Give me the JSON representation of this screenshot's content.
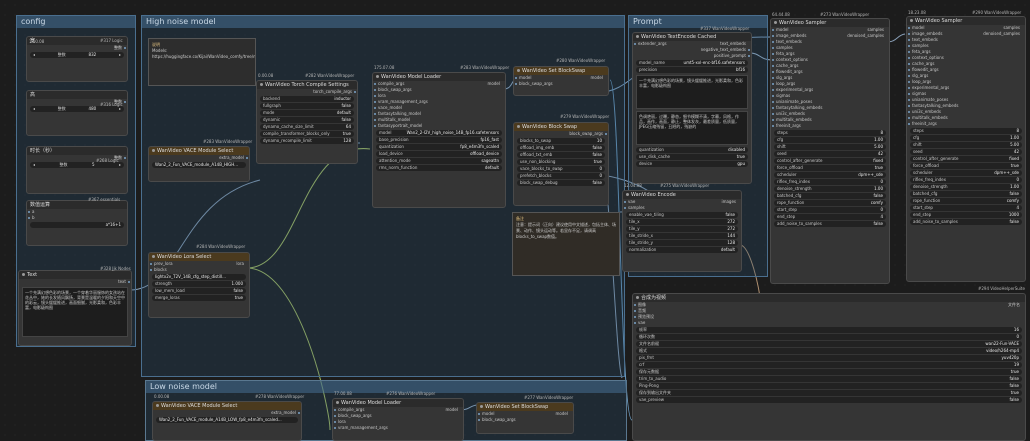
{
  "groups": {
    "config": "config",
    "high": "High noise model",
    "prompt": "Prompt",
    "low": "Low noise model"
  },
  "nodes": {
    "logic1": {
      "id": "#317 Logic",
      "time": "1.00.08",
      "label": "宽",
      "field": "整数",
      "field_value": "832"
    },
    "logic2": {
      "id": "#316 Logic",
      "time": "0.40.08",
      "label": "高",
      "field": "整数",
      "field_value": "480"
    },
    "logic3": {
      "id": "#268 Logic",
      "time": "0.40.08",
      "label": "时长（秒）",
      "field": "整数",
      "field_value": "5"
    },
    "essentials": {
      "id": "#367 essentials",
      "label": "数值运算",
      "a": "a",
      "b": "b",
      "expr": "a*16+1"
    },
    "text": {
      "id": "#328 Jjk Nodes",
      "time": "0.52.08",
      "title": "Text",
      "out": "text",
      "content": "一个充满幻想色彩的场景，一个穿着华丽服饰的女孩站在花丛中，她的长发随风飘扬，背景是温暖的夕阳和天空中的彩云，镜头缓缓推进，画面细腻，光影柔和，色彩丰富，电影级构图"
    },
    "note1": {
      "title": "说明",
      "content": "Models: https://huggingface.co/Kijai/WanVideo_comfy/tree/main/Wan22"
    },
    "compile": {
      "id": "#282 WanVideoWrapper",
      "time": "0.00.08",
      "title": "WanVideo Torch Compile Settings",
      "out": "torch_compile_args",
      "rows": [
        [
          "backend",
          "inductor"
        ],
        [
          "fullgraph",
          "false"
        ],
        [
          "mode",
          "default"
        ],
        [
          "dynamic",
          "false"
        ],
        [
          "dynamo_cache_size_limit",
          "64"
        ],
        [
          "compile_transformer_blocks_only",
          "true"
        ],
        [
          "dynamo_recompile_limit",
          "128"
        ]
      ]
    },
    "loader": {
      "id": "#283 WanVideoWrapper",
      "time": "175.07.08",
      "title": "WanVideo Model Loader",
      "out": "model",
      "ports": [
        "compile_args",
        "block_swap_args",
        "lora",
        "vram_management_args",
        "vace_model",
        "fantasytalking_model",
        "multitalk_model",
        "fantasyportrait_model"
      ],
      "rows": [
        [
          "model",
          "Wan2_2-I2V_high_noise_14B_fp16.safetensors"
        ],
        [
          "base_precision",
          "fp16_fast"
        ],
        [
          "quantization",
          "fp8_e4m3fn_scaled"
        ],
        [
          "load_device",
          "offload_device"
        ],
        [
          "attention_mode",
          "sageattn"
        ],
        [
          "rms_norm_function",
          "default"
        ]
      ]
    },
    "setblock": {
      "id": "#280 WanVideoWrapper",
      "time": "0.00.08",
      "title": "WanVideo Set BlockSwap",
      "ports": [
        "model",
        "block_swap_args"
      ],
      "out": "model"
    },
    "blockswap": {
      "id": "#279 WanVideoWrapper",
      "time": "0.00.08",
      "title": "WanVideo Block Swap",
      "out": "block_swap_args",
      "rows": [
        [
          "blocks_to_swap",
          "10"
        ],
        [
          "offload_img_emb",
          "false"
        ],
        [
          "offload_txt_emb",
          "false"
        ],
        [
          "use_non_blocking",
          "true"
        ],
        [
          "vace_blocks_to_swap",
          "0"
        ],
        [
          "prefetch_blocks",
          "0"
        ],
        [
          "block_swap_debug",
          "false"
        ]
      ]
    },
    "vace": {
      "id": "#283 WanVideoWrapper",
      "time": "0.00.08",
      "title": "WanVideo VACE Module Select",
      "out": "extra_model",
      "value": "Wan2_2_Fun_VACE_module_A14B_HIGH..."
    },
    "lora": {
      "id": "#284 WanVideoWrapper",
      "time": "0.00.08",
      "title": "WanVideo Lora Select",
      "ports": [
        "prev_lora",
        "blocks"
      ],
      "out": "lora",
      "rows": [
        [
          "lora",
          "lightx2v_T2V_14B_cfg_step_distill..."
        ],
        [
          "strength",
          "1.000"
        ],
        [
          "low_mem_load",
          "false"
        ],
        [
          "merge_loras",
          "true"
        ]
      ]
    },
    "note2": {
      "title": "备注",
      "content": "注意：提示词（正向）建议使用中文描述，包括主体、场景、动作、镜头运动等。若显存不足，请调高blocks_to_swap数值。"
    },
    "textencode": {
      "id": "#337 WanVideoWrapper",
      "time": "0.00.08",
      "title": "WanVideo TextEncode Cached",
      "in": "extender_args",
      "outs": [
        "text_embeds",
        "negative_text_embeds",
        "positive_prompt"
      ],
      "rows": [
        [
          "model_name",
          "umt5-xxl-enc-bf16.safetensors"
        ],
        [
          "precision",
          "bf16"
        ]
      ],
      "pos": "一个充满幻想色彩的场景，镜头缓缓推进，光影柔和，色彩丰富，电影级构图",
      "neg": "色调艳丽，过曝，静态，细节模糊不清，字幕，风格，作品，画作，画面，静止，整体发灰，最差质量，低质量，JPEG压缩残留，丑陋的，残缺的",
      "rows2": [
        [
          "quantization",
          "disabled"
        ],
        [
          "use_disk_cache",
          "true"
        ],
        [
          "device",
          "gpu"
        ]
      ]
    },
    "encode": {
      "id": "#275 WanVideoWrapper",
      "time": "12.04.08",
      "title": "WanVideo Encode",
      "ins": [
        "vae",
        "samples"
      ],
      "out": "images",
      "rows": [
        [
          "enable_vae_tiling",
          "false"
        ],
        [
          "tile_x",
          "272"
        ],
        [
          "tile_y",
          "272"
        ],
        [
          "tile_stride_x",
          "144"
        ],
        [
          "tile_stride_y",
          "128"
        ],
        [
          "normalization",
          "default"
        ]
      ]
    },
    "sampler1": {
      "id": "#273 WanVideoWrapper",
      "time": "64.44.08",
      "title": "WanVideo Sampler",
      "ins": [
        "model",
        "image_embeds",
        "text_embeds",
        "samples",
        "feta_args",
        "context_options",
        "cache_args",
        "flowedit_args",
        "slg_args",
        "loop_args",
        "experimental_args",
        "sigmas",
        "unianimate_poses",
        "fantasytalking_embeds",
        "uni3c_embeds",
        "multitalk_embeds",
        "freeinit_args"
      ],
      "outs": [
        "samples",
        "denoised_samples"
      ],
      "rows": [
        [
          "steps",
          "8"
        ],
        [
          "cfg",
          "1.00"
        ],
        [
          "shift",
          "5.00"
        ],
        [
          "seed",
          "42"
        ],
        [
          "control_after_generate",
          "fixed"
        ],
        [
          "force_offload",
          "true"
        ],
        [
          "scheduler",
          "dpm++_sde"
        ],
        [
          "riflex_freq_index",
          "0"
        ],
        [
          "denoise_strength",
          "1.00"
        ],
        [
          "batched_cfg",
          "false"
        ],
        [
          "rope_function",
          "comfy"
        ],
        [
          "start_step",
          "0"
        ],
        [
          "end_step",
          "4"
        ],
        [
          "add_noise_to_samples",
          "false"
        ]
      ]
    },
    "sampler2": {
      "id": "#290 WanVideoWrapper",
      "time": "18.23.08",
      "title": "WanVideo Sampler",
      "ins": [
        "model",
        "image_embeds",
        "text_embeds",
        "samples",
        "feta_args",
        "context_options",
        "cache_args",
        "flowedit_args",
        "slg_args",
        "loop_args",
        "experimental_args",
        "sigmas",
        "unianimate_poses",
        "fantasytalking_embeds",
        "uni3c_embeds",
        "multitalk_embeds",
        "freeinit_args"
      ],
      "outs": [
        "samples",
        "denoised_samples"
      ],
      "rows": [
        [
          "steps",
          "8"
        ],
        [
          "cfg",
          "1.00"
        ],
        [
          "shift",
          "5.00"
        ],
        [
          "seed",
          "42"
        ],
        [
          "control_after_generate",
          "fixed"
        ],
        [
          "force_offload",
          "true"
        ],
        [
          "scheduler",
          "dpm++_sde"
        ],
        [
          "riflex_freq_index",
          "0"
        ],
        [
          "denoise_strength",
          "1.00"
        ],
        [
          "batched_cfg",
          "false"
        ],
        [
          "rope_function",
          "comfy"
        ],
        [
          "start_step",
          "4"
        ],
        [
          "end_step",
          "1000"
        ],
        [
          "add_noise_to_samples",
          "false"
        ]
      ]
    },
    "combine": {
      "id": "#294 VideoHelperSuite",
      "title": "合成为视频",
      "out": "文件名",
      "ins": [
        "图像",
        "音频",
        "预览预设",
        "vae"
      ],
      "rows": [
        [
          "帧率",
          "16"
        ],
        [
          "循环次数",
          "0"
        ],
        [
          "文件名前缀",
          "wan22-Fun-VACE"
        ],
        [
          "格式",
          "video/h264-mp4"
        ],
        [
          "pix_fmt",
          "yuv420p"
        ],
        [
          "crf",
          "19"
        ],
        [
          "保存元数据",
          "true"
        ],
        [
          "trim_to_audio",
          "false"
        ],
        [
          "Ping-Pong",
          "false"
        ],
        [
          "保存到输出文件夹",
          "true"
        ],
        [
          "vae_preview",
          "false"
        ]
      ]
    },
    "lowvace": {
      "id": "#278 WanVideoWrapper",
      "time": "0.00.08",
      "title": "WanVideo VACE Module Select",
      "out": "extra_model",
      "value": "Wan2_2_Fun_VACE_module_A14B_LOW_fp8_e4m3fn_scaled..."
    },
    "lowloader": {
      "id": "#276 WanVideoWrapper",
      "time": "77.00.08",
      "title": "WanVideo Model Loader",
      "out": "model",
      "ports": [
        "compile_args",
        "block_swap_args",
        "lora",
        "vram_management_args"
      ]
    },
    "lowsetblock": {
      "id": "#277 WanVideoWrapper",
      "time": "0.00.08",
      "title": "WanVideo Set BlockSwap",
      "ports": [
        "model",
        "block_swap_args"
      ],
      "out": "model"
    }
  }
}
